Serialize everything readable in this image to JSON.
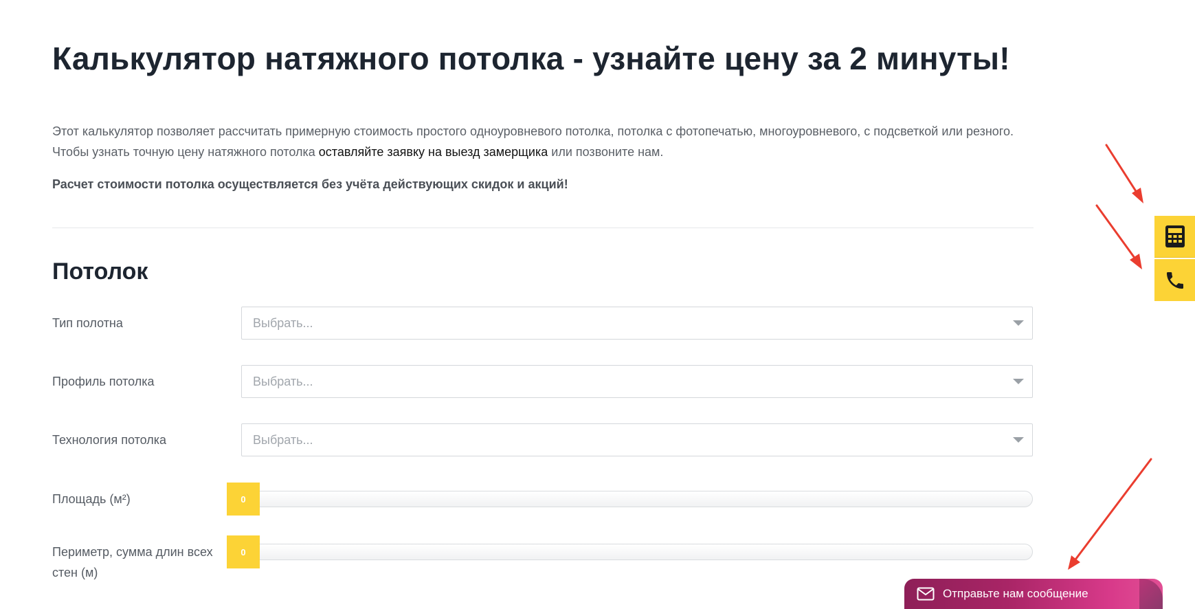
{
  "page": {
    "title": "Калькулятор натяжного потолка - узнайте цену за 2 минуты!",
    "intro_before_link": "Этот калькулятор позволяет рассчитать примерную стоимость простого одноуровневого потолка, потолка с фотопечатью, многоуровневого, с подсветкой или резного. Чтобы узнать точную цену натяжного потолка ",
    "intro_link": "оставляйте заявку на выезд замерщика",
    "intro_after_link": " или позвоните нам.",
    "note": "Расчет стоимости потолка осуществляется без учёта действующих скидок и акций!"
  },
  "section": {
    "title": "Потолок"
  },
  "fields": {
    "canvas_type": {
      "label": "Тип полотна",
      "placeholder": "Выбрать..."
    },
    "profile": {
      "label": "Профиль потолка",
      "placeholder": "Выбрать..."
    },
    "technology": {
      "label": "Технология потолка",
      "placeholder": "Выбрать..."
    },
    "area": {
      "label": "Площадь (м²)",
      "value": "0"
    },
    "perimeter": {
      "label": "Периметр, сумма длин всех стен (м)",
      "value": "0"
    }
  },
  "side_buttons": {
    "calculator_icon": "calculator-icon",
    "phone_icon": "phone-icon"
  },
  "chat": {
    "label": "Отправьте нам сообщение",
    "icon": "envelope-icon"
  },
  "colors": {
    "accent": "#fcd336",
    "chat_gradient_start": "#8e1f58",
    "chat_gradient_end": "#e14f94",
    "annotation_arrow": "#ea3d2f",
    "heading": "#1d2530"
  }
}
